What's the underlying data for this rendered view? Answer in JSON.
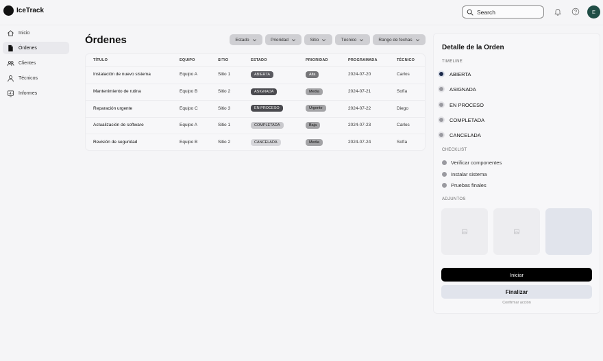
{
  "app": {
    "name": "IceTrack"
  },
  "header": {
    "search_placeholder": "Search",
    "avatar_initial": "E"
  },
  "sidebar": {
    "items": [
      {
        "label": "Inicio",
        "icon": "home-icon",
        "active": false
      },
      {
        "label": "Órdenes",
        "icon": "document-icon",
        "active": true
      },
      {
        "label": "Clientes",
        "icon": "users-icon",
        "active": false
      },
      {
        "label": "Técnicos",
        "icon": "user-icon",
        "active": false
      },
      {
        "label": "Informes",
        "icon": "report-icon",
        "active": false
      }
    ]
  },
  "main": {
    "title": "Órdenes",
    "filters": [
      "Estado",
      "Prioridad",
      "Sitio",
      "Técnico",
      "Rango de fechas"
    ],
    "table": {
      "columns": [
        "TÍTULO",
        "EQUIPO",
        "SITIO",
        "ESTADO",
        "PRIORIDAD",
        "PROGRAMADA",
        "TÉCNICO"
      ],
      "rows": [
        {
          "titulo": "Instalación de nuevo sistema",
          "equipo": "Equipo A",
          "sitio": "Sitio 1",
          "estado": "ABIERTA",
          "prioridad": "Alta",
          "programada": "2024-07-20",
          "tecnico": "Carlos"
        },
        {
          "titulo": "Mantenimiento de rutina",
          "equipo": "Equipo B",
          "sitio": "Sitio 2",
          "estado": "ASIGNADA",
          "prioridad": "Media",
          "programada": "2024-07-21",
          "tecnico": "Sofía"
        },
        {
          "titulo": "Reparación urgente",
          "equipo": "Equipo C",
          "sitio": "Sitio 3",
          "estado": "EN PROCESO",
          "prioridad": "Urgente",
          "programada": "2024-07-22",
          "tecnico": "Diego"
        },
        {
          "titulo": "Actualización de software",
          "equipo": "Equipo A",
          "sitio": "Sitio 1",
          "estado": "COMPLETADA",
          "prioridad": "Baja",
          "programada": "2024-07-23",
          "tecnico": "Carlos"
        },
        {
          "titulo": "Revisión de seguridad",
          "equipo": "Equipo B",
          "sitio": "Sitio 2",
          "estado": "CANCELADA",
          "prioridad": "Media",
          "programada": "2024-07-24",
          "tecnico": "Sofía"
        }
      ]
    }
  },
  "detail": {
    "title": "Detalle de la Orden",
    "timeline_label": "TIMELINE",
    "timeline": [
      "ABIERTA",
      "ASIGNADA",
      "EN PROCESO",
      "COMPLETADA",
      "CANCELADA"
    ],
    "timeline_current": "ABIERTA",
    "checklist_label": "CHECKLIST",
    "checklist": [
      "Verificar componentes",
      "Instalar sistema",
      "Pruebas finales"
    ],
    "attachments_label": "ADJUNTOS",
    "start_label": "Iniciar",
    "finish_label": "Finalizar",
    "confirm_label": "Confirmar acción"
  },
  "colors": {
    "accent": "#000000",
    "avatar": "#1f4d45",
    "timeline_current": "#1c2a4a"
  }
}
